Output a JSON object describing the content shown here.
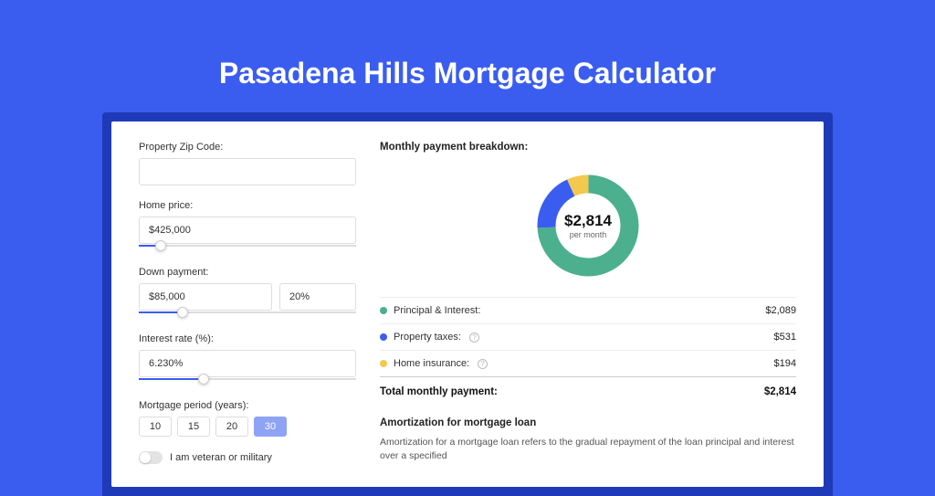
{
  "title": "Pasadena Hills Mortgage Calculator",
  "form": {
    "zip_label": "Property Zip Code:",
    "zip_value": "",
    "home_price_label": "Home price:",
    "home_price_value": "$425,000",
    "down_payment_label": "Down payment:",
    "down_payment_value": "$85,000",
    "down_payment_pct": "20%",
    "interest_label": "Interest rate (%):",
    "interest_value": "6.230%",
    "period_label": "Mortgage period (years):",
    "period_options": [
      "10",
      "15",
      "20",
      "30"
    ],
    "period_selected": "30",
    "veteran_label": "I am veteran or military"
  },
  "breakdown": {
    "title": "Monthly payment breakdown:",
    "center_amount": "$2,814",
    "center_sub": "per month",
    "items": [
      {
        "label": "Principal & Interest:",
        "amount": "$2,089",
        "color": "#4CAF8E",
        "help": false
      },
      {
        "label": "Property taxes:",
        "amount": "$531",
        "color": "#3A5DF0",
        "help": true
      },
      {
        "label": "Home insurance:",
        "amount": "$194",
        "color": "#F2C94C",
        "help": true
      }
    ],
    "total_label": "Total monthly payment:",
    "total_amount": "$2,814"
  },
  "amort": {
    "title": "Amortization for mortgage loan",
    "text": "Amortization for a mortgage loan refers to the gradual repayment of the loan principal and interest over a specified"
  },
  "chart_data": {
    "type": "pie",
    "title": "Monthly payment breakdown",
    "categories": [
      "Principal & Interest",
      "Property taxes",
      "Home insurance"
    ],
    "values": [
      2089,
      531,
      194
    ],
    "colors": [
      "#4CAF8E",
      "#3A5DF0",
      "#F2C94C"
    ],
    "total": 2814
  }
}
